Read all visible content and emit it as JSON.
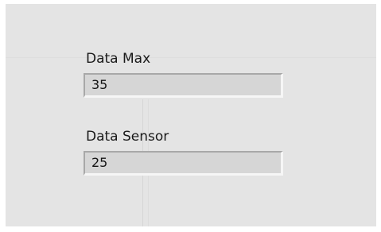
{
  "controls": {
    "data_max": {
      "label": "Data Max",
      "value": "35"
    },
    "data_sensor": {
      "label": "Data Sensor",
      "value": "25"
    }
  }
}
